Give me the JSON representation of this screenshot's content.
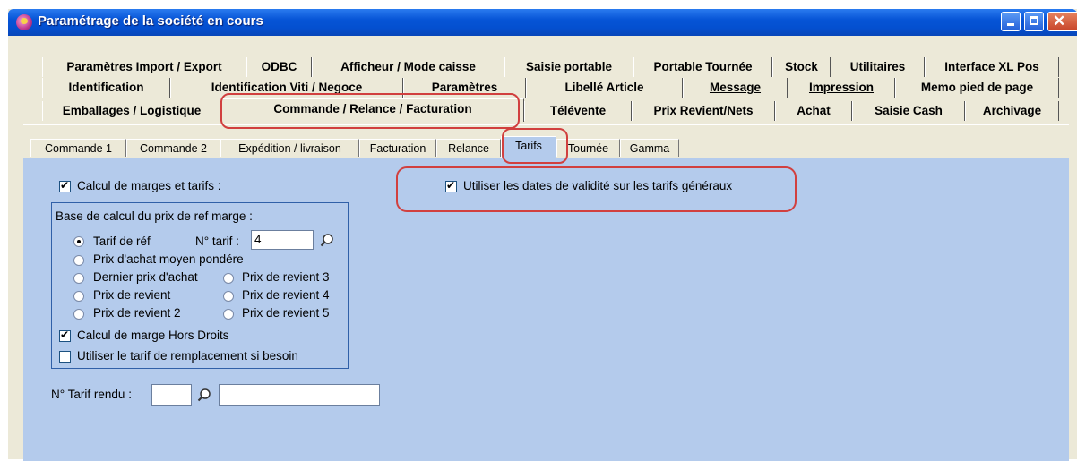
{
  "window": {
    "title": "Paramétrage de la société en cours"
  },
  "tabs": {
    "row1": [
      "Paramètres Import / Export",
      "ODBC",
      "Afficheur / Mode caisse",
      "Saisie portable",
      "Portable Tournée",
      "Stock",
      "Utilitaires",
      "Interface XL Pos"
    ],
    "row2": [
      "Identification",
      "Identification Viti / Negoce",
      "Paramètres",
      "Libellé Article",
      "Message",
      "Impression",
      "Memo pied de page"
    ],
    "row3": [
      "Emballages / Logistique",
      "Commande / Relance / Facturation",
      "Télévente",
      "Prix Revient/Nets",
      "Achat",
      "Saisie Cash",
      "Archivage"
    ],
    "selected": "Commande / Relance / Facturation"
  },
  "subtabs": {
    "items": [
      "Commande 1",
      "Commande 2",
      "Expédition / livraison",
      "Facturation",
      "Relance",
      "Tarifs",
      "Tournée",
      "Gamma"
    ],
    "selected": "Tarifs"
  },
  "tarifs": {
    "calcul_marges": {
      "label": "Calcul de marges et tarifs :",
      "checked": true
    },
    "utiliser_dates": {
      "label": "Utiliser les dates de validité sur les tarifs généraux",
      "checked": true
    },
    "base_calcul": {
      "title": "Base de calcul du prix de ref marge :",
      "tarif_ref": "Tarif de réf",
      "num_tarif_label": "N° tarif :",
      "num_tarif_value": "4",
      "prix_achat_moyen": "Prix d'achat moyen pondére",
      "dernier_prix_achat": "Dernier prix d'achat",
      "prix_revient": "Prix de revient",
      "prix_revient_2": "Prix de revient 2",
      "prix_revient_3": "Prix de revient 3",
      "prix_revient_4": "Prix de revient 4",
      "prix_revient_5": "Prix de revient 5",
      "selected": "Tarif de réf",
      "hors_droits": {
        "label": "Calcul de marge Hors Droits",
        "checked": true
      },
      "remplacement": {
        "label": "Utiliser le tarif de remplacement si besoin",
        "checked": false
      }
    },
    "tarif_rendu": {
      "label": "N° Tarif rendu :",
      "code": "",
      "description": ""
    }
  },
  "colors": {
    "title_bar": "#0654D6",
    "panel_bg": "#B4CBEC",
    "dialog_bg": "#ECE9D8",
    "highlight": "#d1403f"
  }
}
